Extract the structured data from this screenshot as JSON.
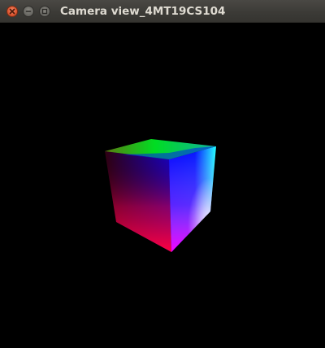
{
  "window": {
    "title": "Camera view_4MT19CS104"
  },
  "titlebar_buttons": {
    "close_icon": "close-icon",
    "minimize_icon": "minimize-icon",
    "maximize_icon": "maximize-icon"
  },
  "viewport": {
    "background_color": "#000000",
    "object": "rgb-color-cube",
    "face_colors": {
      "top": [
        "#ffff00",
        "#00ff00",
        "#00ffff",
        "#ffffff"
      ],
      "front": [
        "#0000ff",
        "#00ffff",
        "#ff00ff",
        "#ff0000"
      ],
      "side": [
        "#000000",
        "#ff0000",
        "#ff00ff",
        "#0000ff"
      ]
    }
  }
}
